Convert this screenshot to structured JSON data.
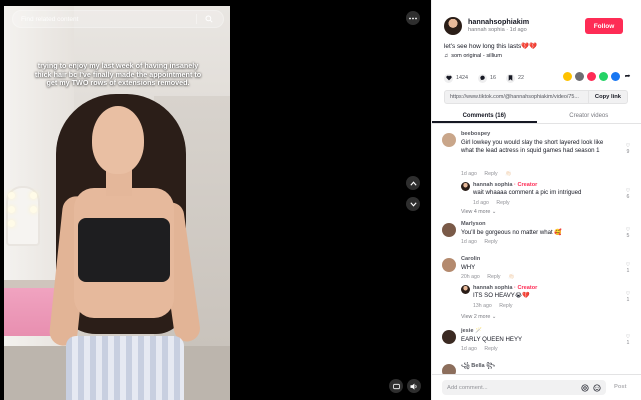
{
  "search": {
    "placeholder": "Find related content"
  },
  "video": {
    "caption": "trying to enjoy my last week of having insanely thick hair bc I've finally made the appointment to get my TWO rows of extensions removed."
  },
  "author": {
    "username": "hannahsophiakim",
    "subline": "hannah sophia · 1d ago",
    "follow_label": "Follow"
  },
  "post": {
    "description": "let's see how long this lasts💔💔",
    "music": "som original - sillium",
    "likes": "1424",
    "comments": "16",
    "saves": "22",
    "link": "https://www.tiktok.com/@hannahsophiakim/video/75...",
    "copy_label": "Copy link"
  },
  "tabs": [
    {
      "label": "Comments (16)"
    },
    {
      "label": "Creator videos"
    }
  ],
  "comments": [
    {
      "user": "beebospey",
      "text": "Girl lowkey you would slay the short layered look like what the lead actress in squid games had season 1",
      "time": "1d ago",
      "reply": "Reply",
      "likes": "9",
      "replies": [
        {
          "user": "hannah sophia",
          "badge": "· Creator",
          "text": "wait whaaaa comment a pic im intrigued",
          "time": "1d ago",
          "reply": "Reply",
          "likes": "6"
        }
      ],
      "view_more": "View 4 more ⌄"
    },
    {
      "user": "Marlyson",
      "text": "You'll be gorgeous no matter what 🥰",
      "time": "1d ago",
      "reply": "Reply",
      "likes": "5"
    },
    {
      "user": "Carolin",
      "text": "WHY",
      "time": "20h ago",
      "reply": "Reply",
      "likes": "1",
      "replies": [
        {
          "user": "hannah sophia",
          "badge": "· Creator",
          "text": "ITS SO HEAVY😭💔",
          "time": "13h ago",
          "reply": "Reply",
          "likes": "1"
        }
      ],
      "view_more": "View 2 more ⌄"
    },
    {
      "user": "jesie 🪄",
      "text": "EARLY QUEEN HEYY",
      "time": "1d ago",
      "reply": "Reply",
      "likes": "1"
    },
    {
      "user": "꧁ Bella ꧂",
      "text": "",
      "time": "",
      "reply": "",
      "likes": ""
    }
  ],
  "comment_box": {
    "placeholder": "Add comment...",
    "post_label": "Post"
  },
  "colors": {
    "accent": "#fe2c55",
    "video_bg": "#000000"
  }
}
